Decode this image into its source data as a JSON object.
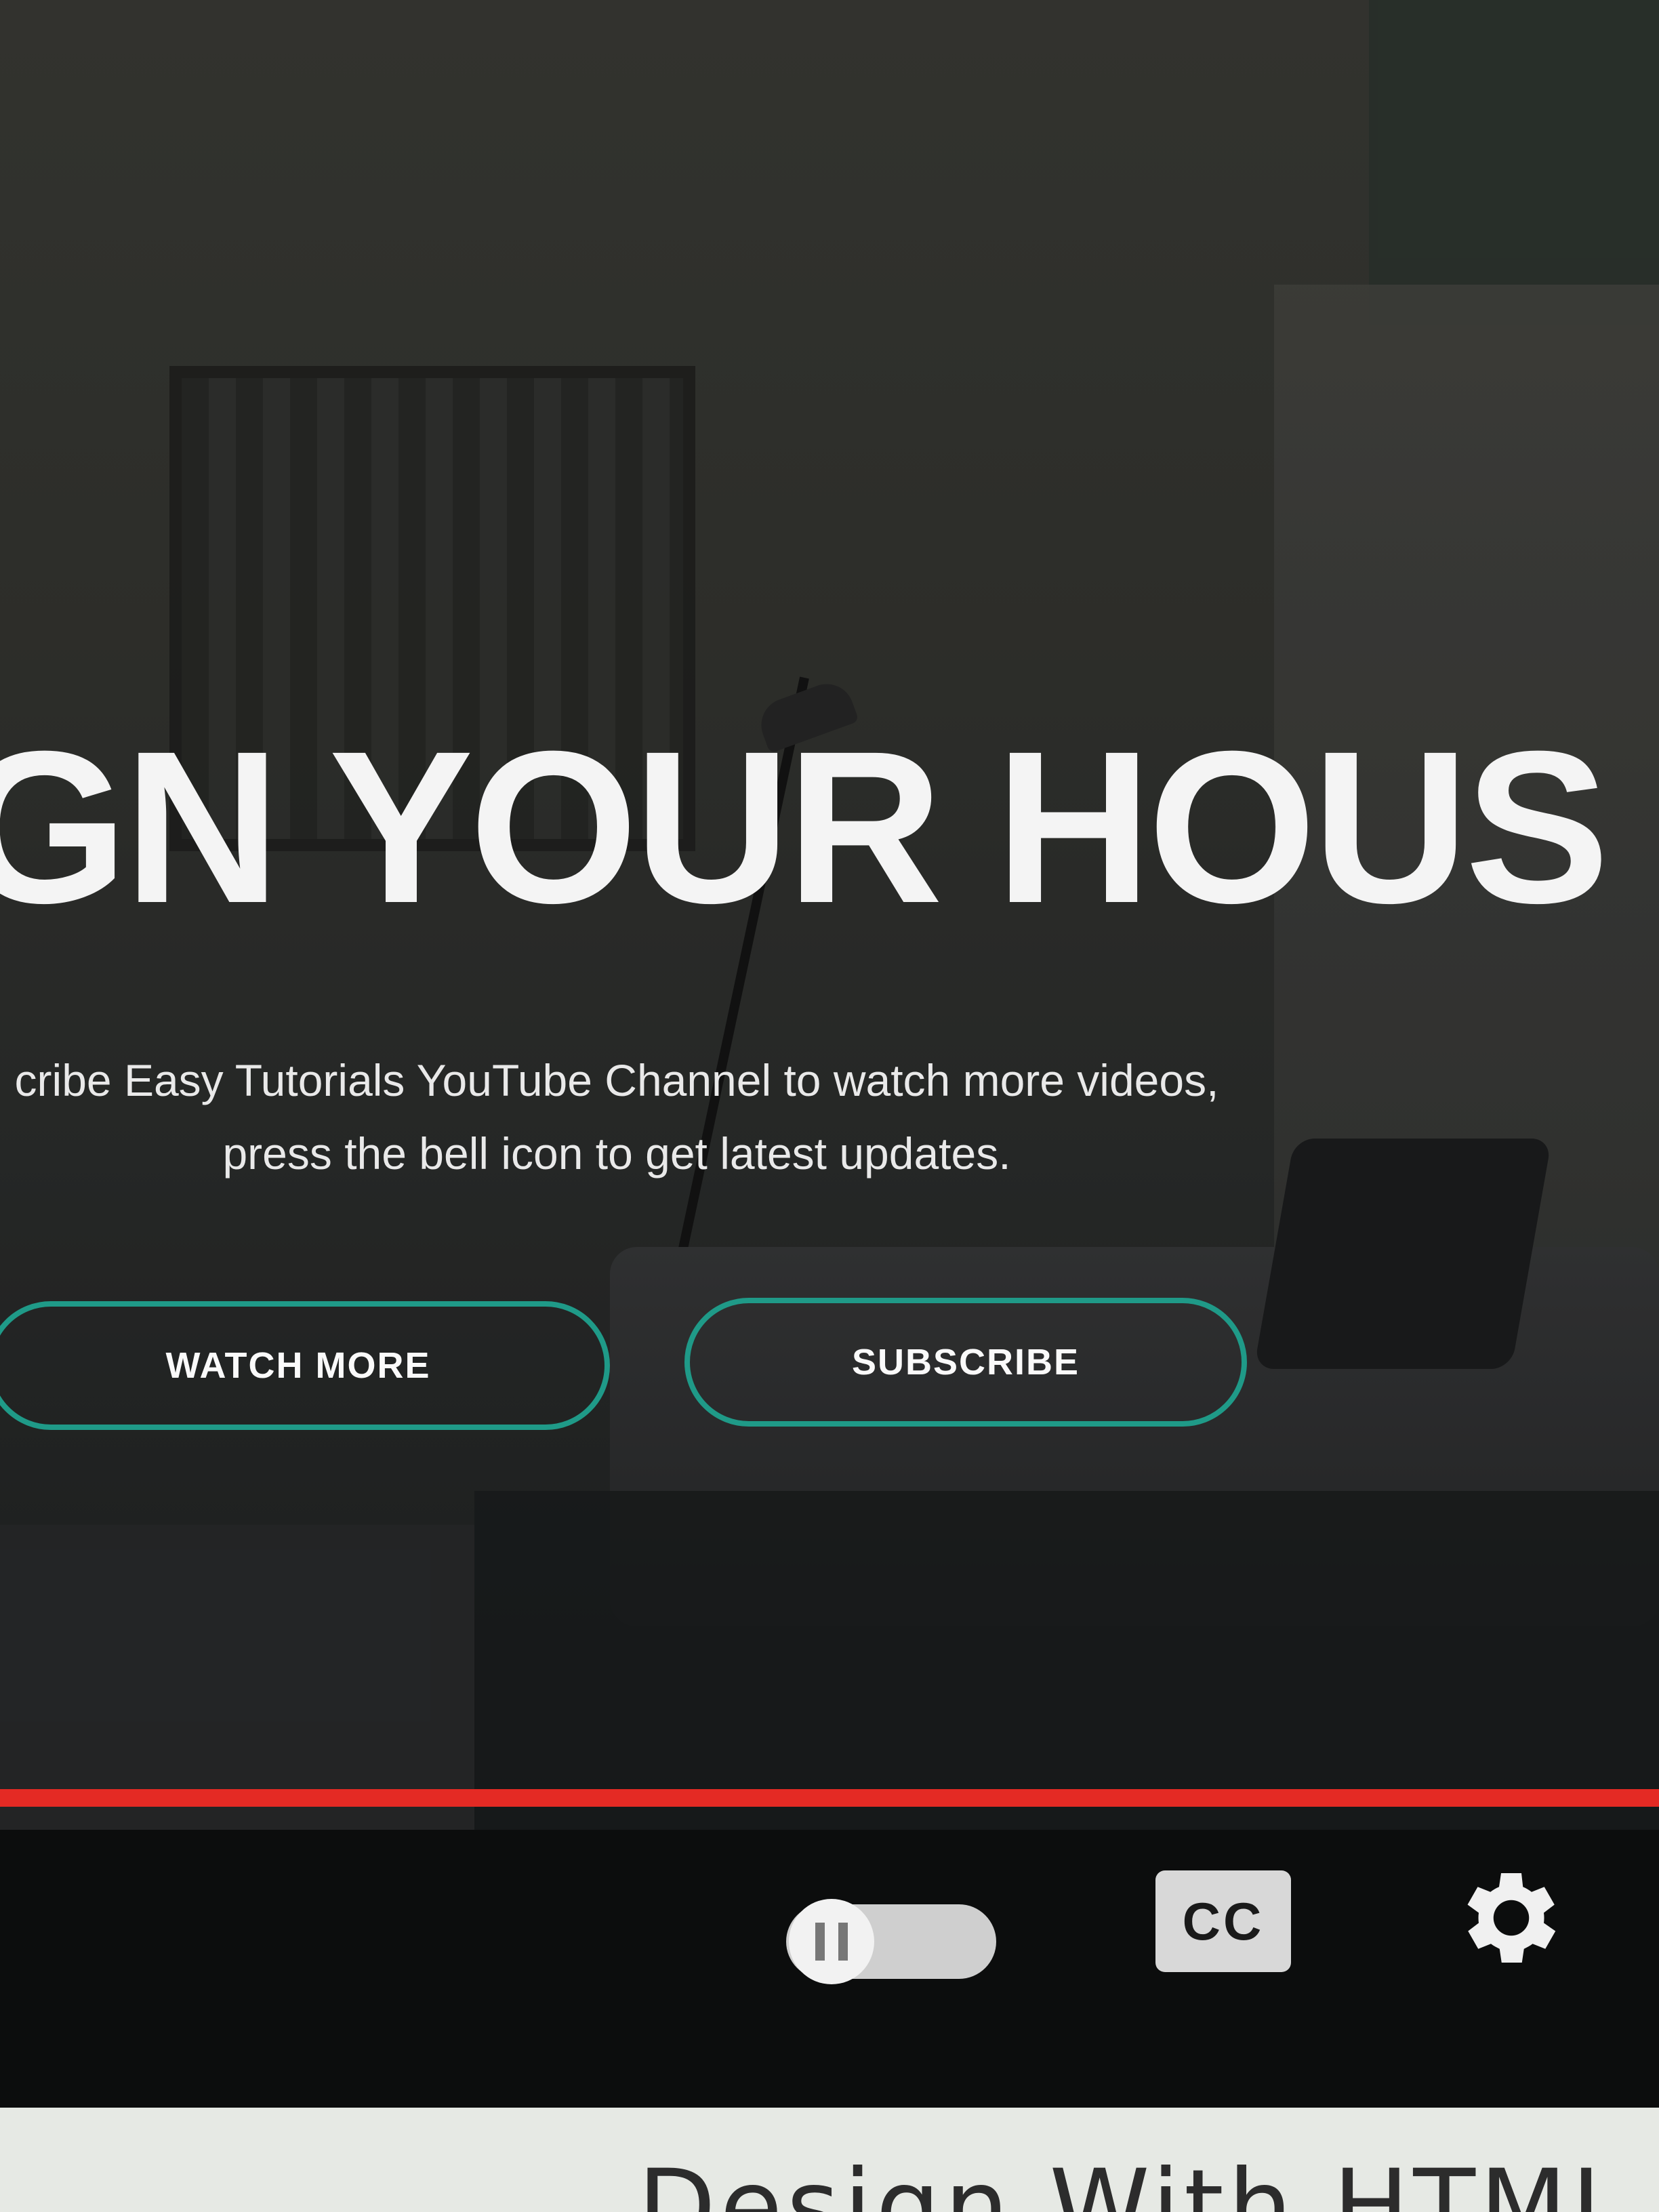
{
  "hero": {
    "title": "GN YOUR HOUS",
    "subtitle_line1": "cribe Easy Tutorials YouTube Channel to watch more videos,",
    "subtitle_line2": "press the bell icon to get latest updates.",
    "buttons": {
      "watch_more": "WATCH MORE",
      "subscribe": "SUBSCRIBE"
    },
    "accent_color": "#1f9a88"
  },
  "player": {
    "progress_fraction": 1.0,
    "progress_color": "#e42a24",
    "controls": {
      "autoplay_icon": "autoplay-toggle-icon",
      "cc_label": "CC",
      "settings_icon": "gear-icon"
    }
  },
  "below_player": {
    "video_title_partial": "Design With HTML"
  }
}
